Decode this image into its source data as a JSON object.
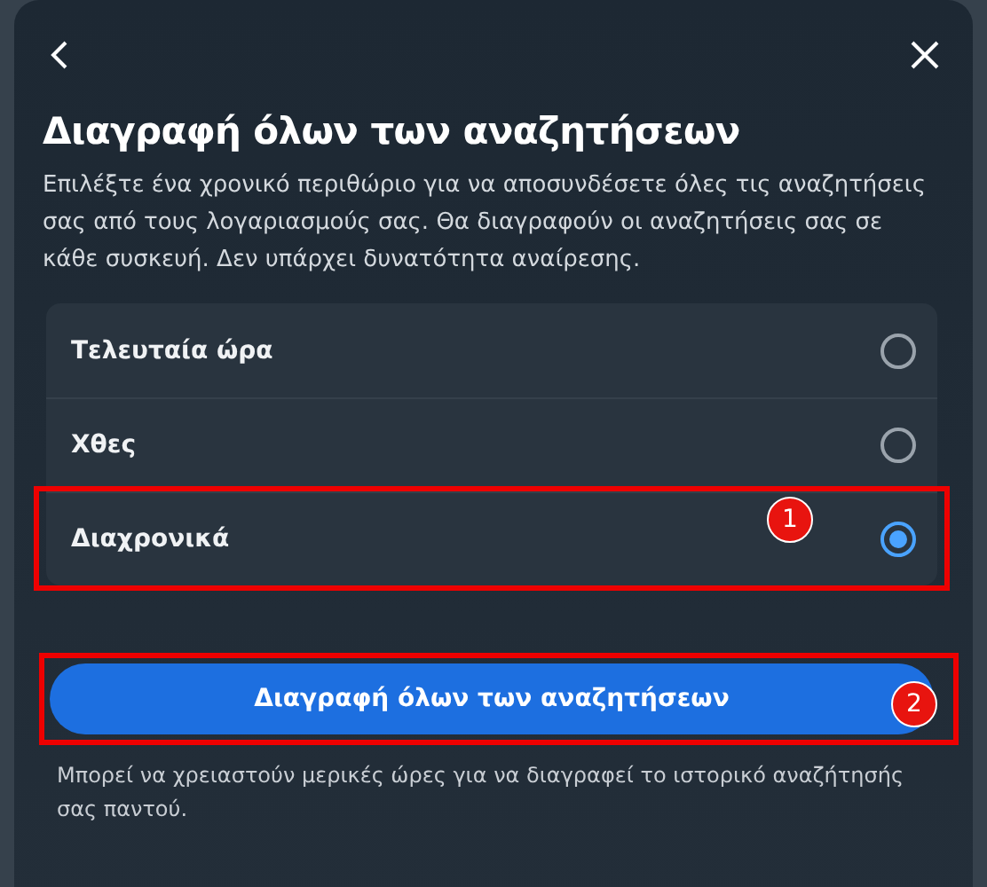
{
  "dialog": {
    "title": "Διαγραφή όλων των αναζητήσεων",
    "description": "Επιλέξτε ένα χρονικό περιθώριο για να αποσυνδέσετε όλες τις αναζητήσεις σας από τους λογαριασμούς σας. Θα διαγραφούν οι αναζητήσεις σας σε κάθε συσκευή. Δεν υπάρχει δυνατότητα αναίρεσης.",
    "options": [
      {
        "label": "Τελευταία ώρα",
        "selected": false
      },
      {
        "label": "Χθες",
        "selected": false
      },
      {
        "label": "Διαχρονικά",
        "selected": true,
        "annotation": "1"
      }
    ],
    "button": {
      "label": "Διαγραφή όλων των αναζητήσεων",
      "annotation": "2"
    },
    "footnote": "Μπορεί να χρειαστούν μερικές ώρες για να διαγραφεί το ιστορικό αναζήτησής σας παντού."
  }
}
